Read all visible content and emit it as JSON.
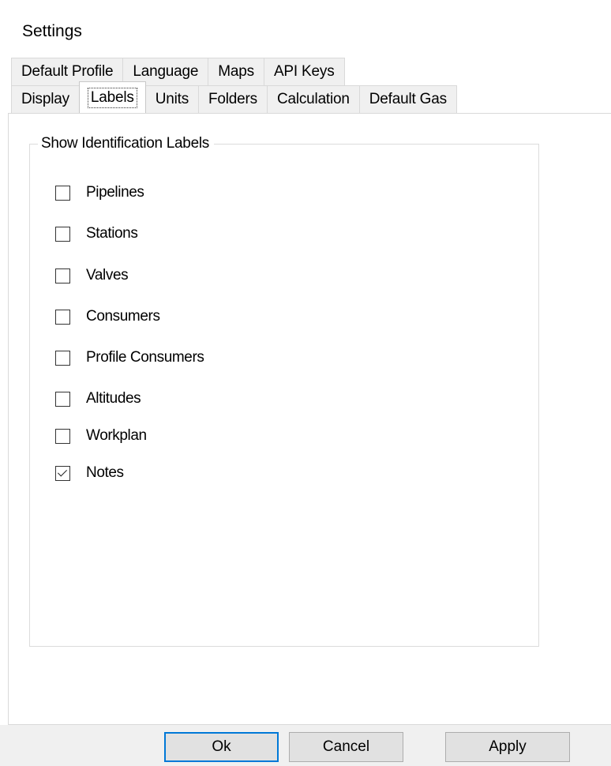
{
  "window": {
    "title": "Settings"
  },
  "tabs": {
    "back_row": [
      "Default Profile",
      "Language",
      "Maps",
      "API Keys"
    ],
    "front_row": [
      "Display",
      "Labels",
      "Units",
      "Folders",
      "Calculation",
      "Default Gas"
    ],
    "selected": "Labels"
  },
  "labels_page": {
    "group_title": "Show Identification Labels",
    "checkboxes": [
      {
        "label": "Pipelines",
        "checked": false
      },
      {
        "label": "Stations",
        "checked": false
      },
      {
        "label": "Valves",
        "checked": false
      },
      {
        "label": "Consumers",
        "checked": false
      },
      {
        "label": "Profile Consumers",
        "checked": false
      },
      {
        "label": "Altitudes",
        "checked": false
      },
      {
        "label": "Workplan",
        "checked": false
      },
      {
        "label": "Notes",
        "checked": true
      }
    ]
  },
  "buttons": {
    "ok": "Ok",
    "cancel": "Cancel",
    "apply": "Apply"
  },
  "colors": {
    "default_button_border": "#0078d7",
    "dialog_bg": "#f0f0f0"
  }
}
